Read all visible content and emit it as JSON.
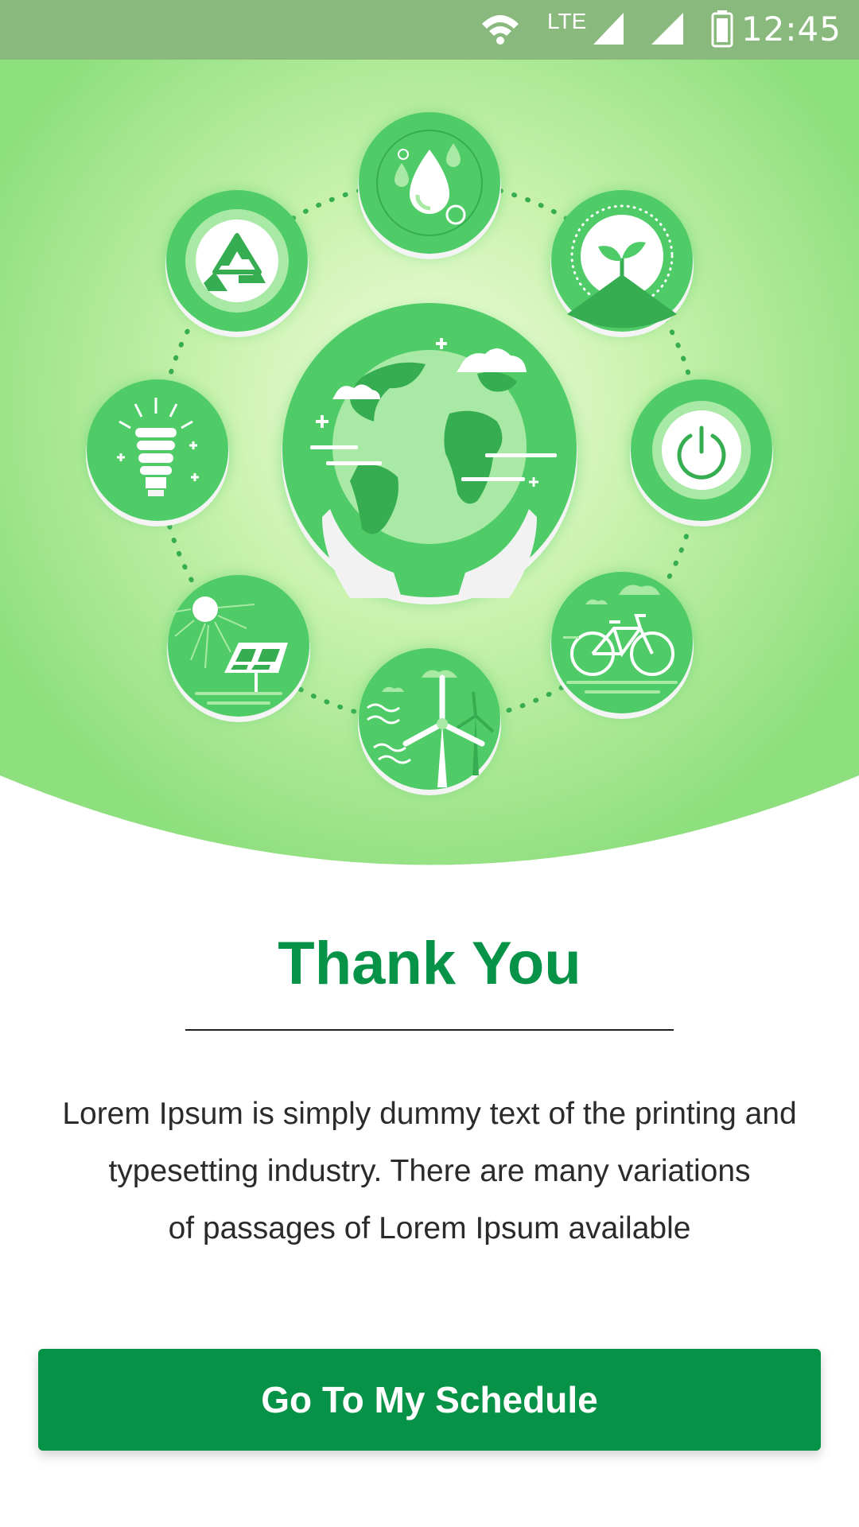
{
  "status_bar": {
    "network_label": "LTE",
    "time": "12:45",
    "icons": [
      "wifi-icon",
      "signal-icon",
      "signal-icon",
      "battery-icon"
    ]
  },
  "illustration": {
    "center": "earth-in-hands-icon",
    "orbit_icons": [
      "water-drop-icon",
      "sprout-icon",
      "power-icon",
      "bicycle-icon",
      "wind-turbine-icon",
      "solar-panel-icon",
      "light-bulb-icon",
      "recycle-icon"
    ]
  },
  "content": {
    "title": "Thank You",
    "description_lines": [
      "Lorem Ipsum is simply dummy text of the printing and",
      "typesetting industry. There are many variations",
      "of passages of Lorem Ipsum available"
    ]
  },
  "actions": {
    "primary_label": "Go To My Schedule"
  },
  "colors": {
    "primary": "#079347",
    "status_bar": "#8ab97d",
    "hero_light": "#eafcd0",
    "hero_mid": "#b9eda0",
    "icon_circle": "#4fcb68",
    "icon_dark": "#37ad51"
  }
}
